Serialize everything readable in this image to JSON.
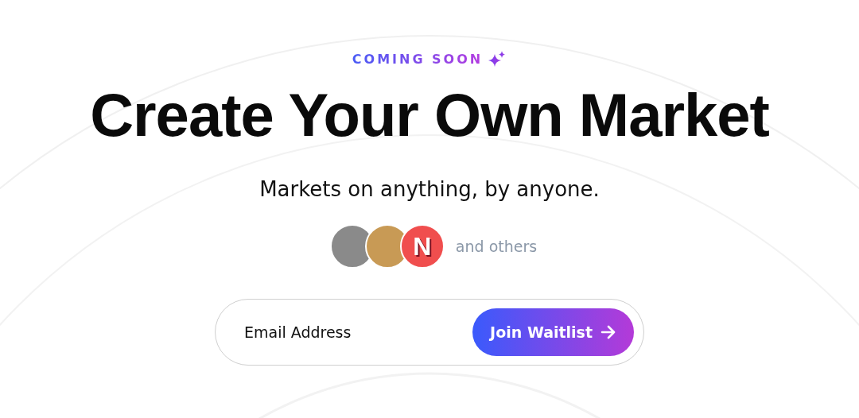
{
  "badge": {
    "text": "COMING SOON"
  },
  "headline": "Create Your Own Market",
  "subtitle": "Markets on anything, by anyone.",
  "avatars": [
    {
      "kind": "photo"
    },
    {
      "kind": "photo"
    },
    {
      "kind": "logo",
      "letter": "N"
    }
  ],
  "avatars_caption": "and others",
  "signup": {
    "placeholder": "Email Address",
    "button": "Join Waitlist"
  }
}
